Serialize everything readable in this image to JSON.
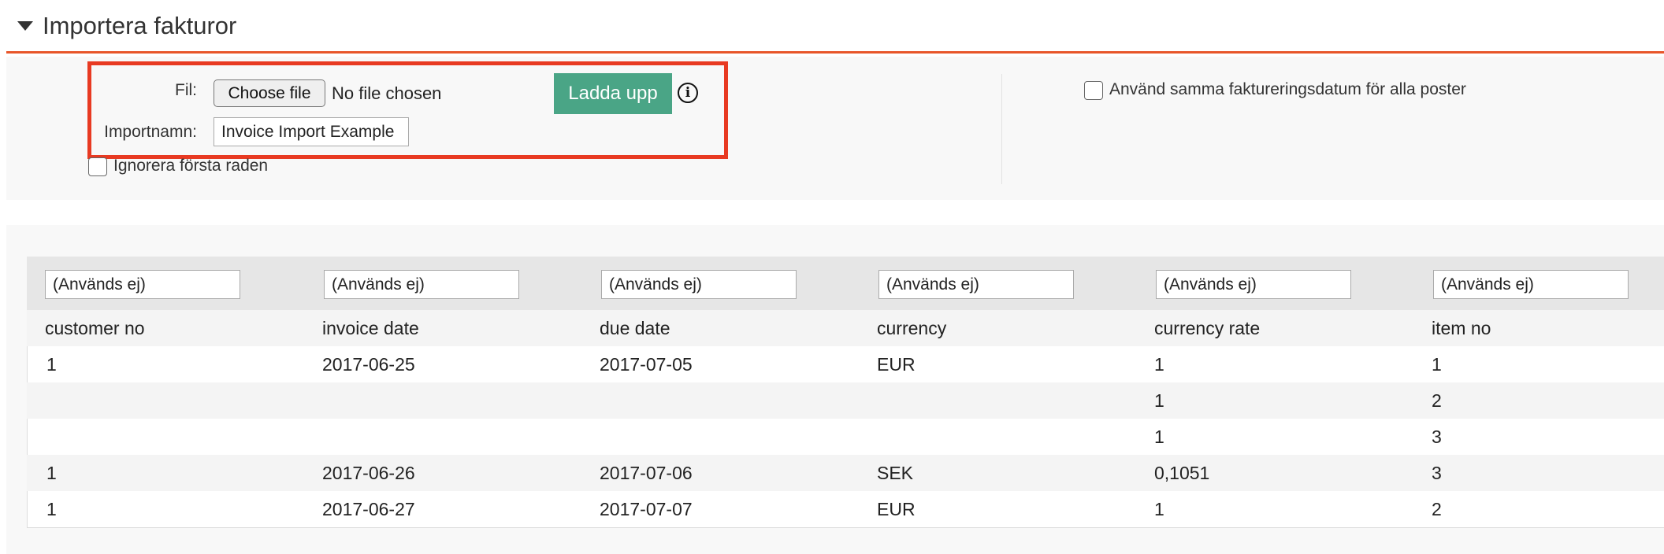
{
  "section": {
    "title": "Importera fakturor"
  },
  "form": {
    "file_label": "Fil:",
    "choose_file_label": "Choose file",
    "no_file_text": "No file chosen",
    "upload_label": "Ladda upp",
    "info_icon": "info-icon",
    "import_name_label": "Importnamn:",
    "import_name_value": "Invoice Import Example",
    "ignore_first_row_label": "Ignorera första raden",
    "same_date_label": "Använd samma faktureringsdatum för alla poster"
  },
  "colors": {
    "accent": "#e8562a",
    "upload": "#4aa586",
    "highlight": "#e83a22"
  },
  "table": {
    "mapping": [
      "(Används ej)",
      "(Används ej)",
      "(Används ej)",
      "(Används ej)",
      "(Används ej)",
      "(Används ej)"
    ],
    "headers": [
      "customer no",
      "invoice date",
      "due date",
      "currency",
      "currency rate",
      "item no"
    ],
    "rows": [
      [
        "1",
        "2017-06-25",
        "2017-07-05",
        "EUR",
        "1",
        "1"
      ],
      [
        "",
        "",
        "",
        "",
        "1",
        "2"
      ],
      [
        "",
        "",
        "",
        "",
        "1",
        "3"
      ],
      [
        "1",
        "2017-06-26",
        "2017-07-06",
        "SEK",
        "0,1051",
        "3"
      ],
      [
        "1",
        "2017-06-27",
        "2017-07-07",
        "EUR",
        "1",
        "2"
      ]
    ]
  }
}
